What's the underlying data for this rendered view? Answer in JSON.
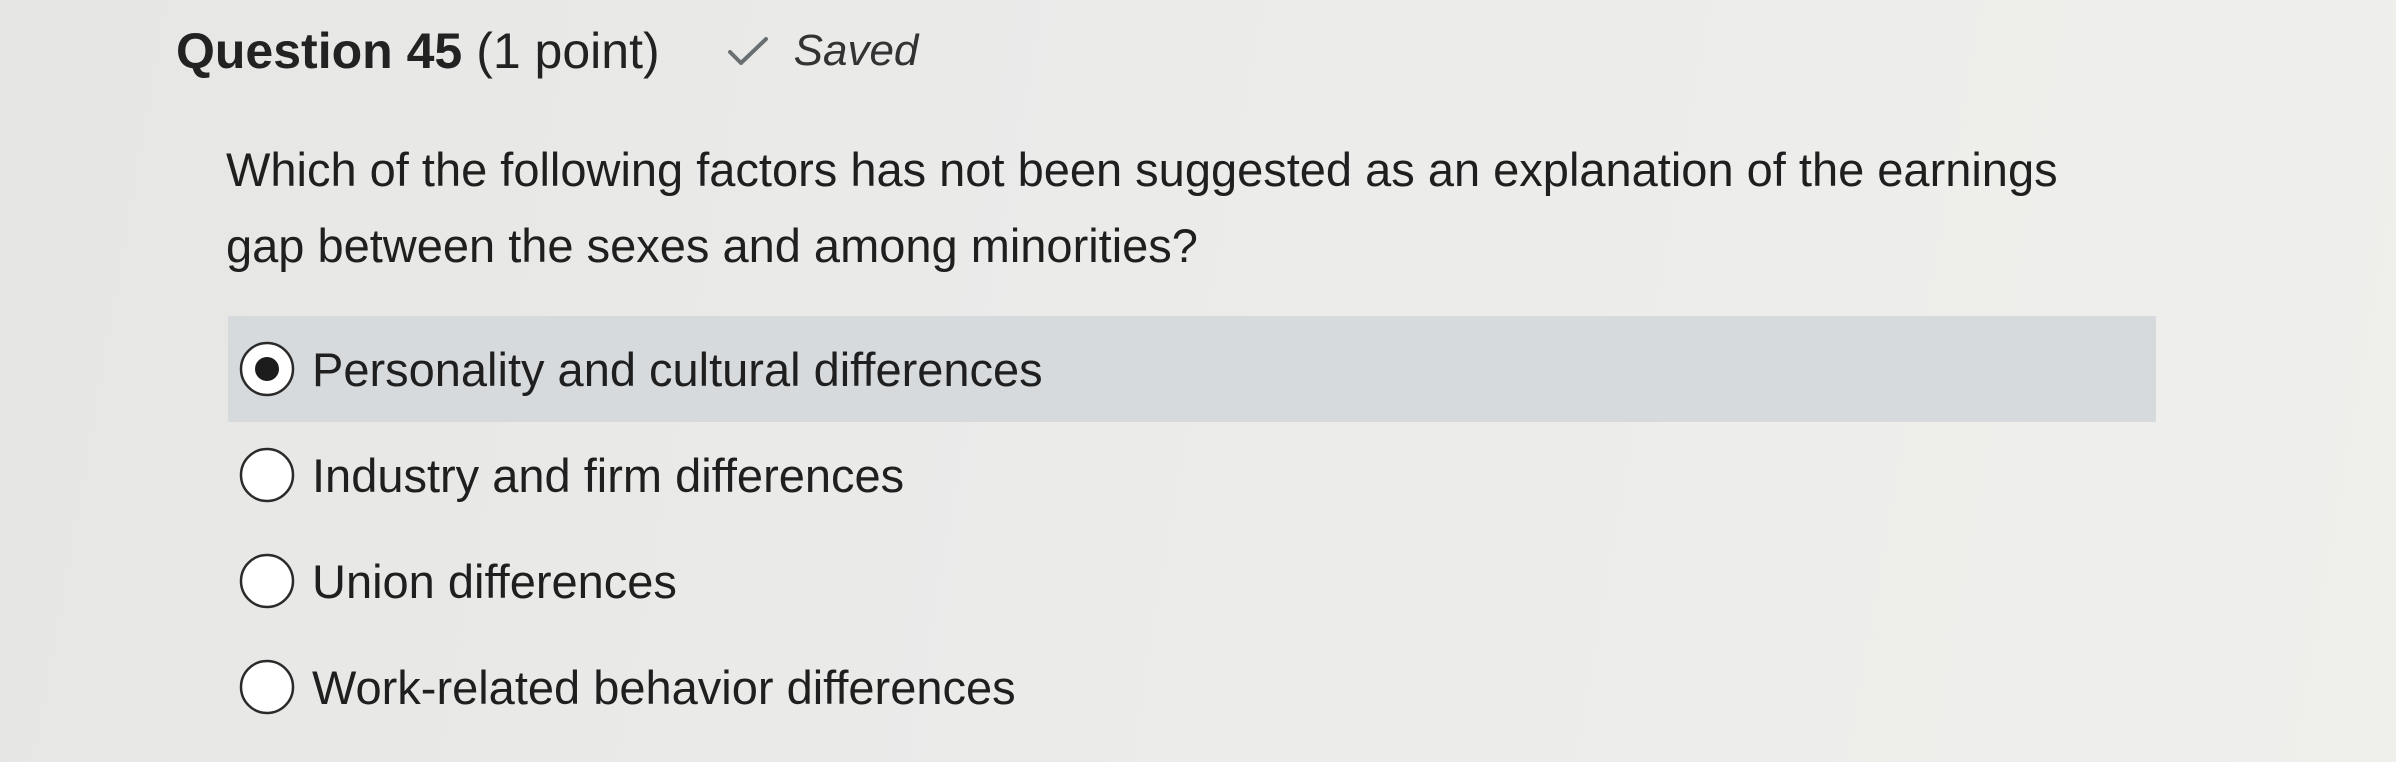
{
  "question": {
    "title": "Question 45",
    "points": "(1 point)",
    "status": "Saved",
    "status_icon": "checkmark-icon",
    "text": "Which of the following factors has not been suggested as an explanation of the earnings gap between the sexes and among minorities?"
  },
  "options": [
    {
      "label": "Personality and cultural differences",
      "selected": true
    },
    {
      "label": "Industry and firm differences",
      "selected": false
    },
    {
      "label": "Union differences",
      "selected": false
    },
    {
      "label": "Work-related behavior differences",
      "selected": false
    }
  ],
  "colors": {
    "selected_row": "#d6dadd",
    "background": "#ebebea",
    "text": "#1f1f1f"
  }
}
